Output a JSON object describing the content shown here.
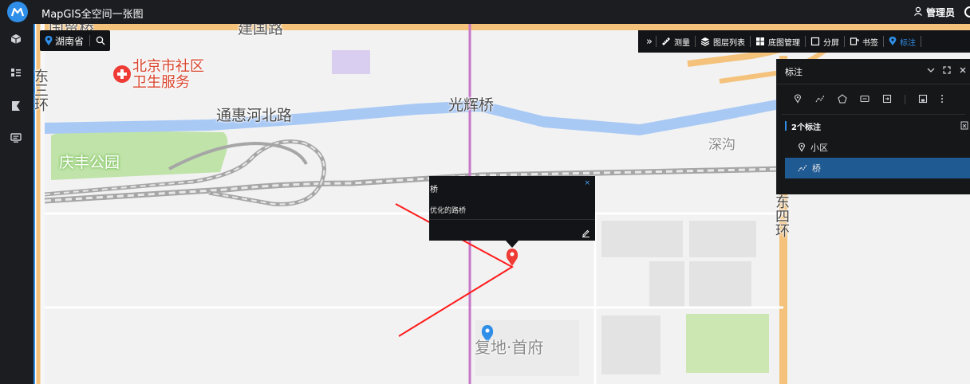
{
  "app": {
    "title": "MapGIS全空间一张图"
  },
  "user": {
    "name": "管理员",
    "icon": "user-icon"
  },
  "sidebar": {
    "items": [
      {
        "icon": "cube-icon"
      },
      {
        "icon": "layers-list-icon"
      },
      {
        "icon": "flag-icon"
      },
      {
        "icon": "monitor-icon"
      }
    ]
  },
  "region": {
    "name": "湖南省",
    "icon": "location-icon",
    "search_icon": "search-icon"
  },
  "toolbar": {
    "collapse_label": "»",
    "items": [
      {
        "label": "测量",
        "icon": "ruler-icon"
      },
      {
        "label": "图层列表",
        "icon": "layers-icon"
      },
      {
        "label": "底图管理",
        "icon": "grid-icon"
      },
      {
        "label": "分屏",
        "icon": "split-screen-icon"
      },
      {
        "label": "书签",
        "icon": "bookmark-icon"
      },
      {
        "label": "标注",
        "icon": "marker-icon",
        "active": true
      }
    ]
  },
  "map_labels": {
    "jianguo_road": "建国路",
    "beijing_community": "北京市社区",
    "health_service": "卫生服务",
    "ring_road_east3": "东三环",
    "tonghui_north": "通惠河北路",
    "guanghui_bridge": "光辉桥",
    "qingfeng_park": "庆丰公园",
    "shengou": "深沟",
    "ring_road_east4": "东四环",
    "fudi_shoufu": "复地·首府",
    "top_partial": "国贸桥"
  },
  "panel": {
    "title": "标注",
    "header_icons": [
      "chevron-down-icon",
      "expand-icon",
      "close-icon"
    ],
    "tools": [
      "point-marker-icon",
      "polyline-icon",
      "polygon-icon",
      "text-box-icon",
      "import-icon",
      "save-icon",
      "more-icon"
    ],
    "count_label": "2个标注",
    "items": [
      {
        "label": "小区",
        "icon": "location-outline-icon",
        "selected": false
      },
      {
        "label": "桥",
        "icon": "polyline-icon",
        "selected": true
      }
    ]
  },
  "popup": {
    "title": "桥",
    "close": "×",
    "description": "优化的路桥",
    "edit_icon": "edit-icon"
  },
  "colors": {
    "accent": "#2f8ee8",
    "river": "#a9c9f5",
    "park": "#bfe3a8",
    "annotation_line": "#ff1a1a",
    "marker_red": "#ef3b35",
    "marker_blue": "#2f8ee8",
    "rail": "#c678c6"
  }
}
